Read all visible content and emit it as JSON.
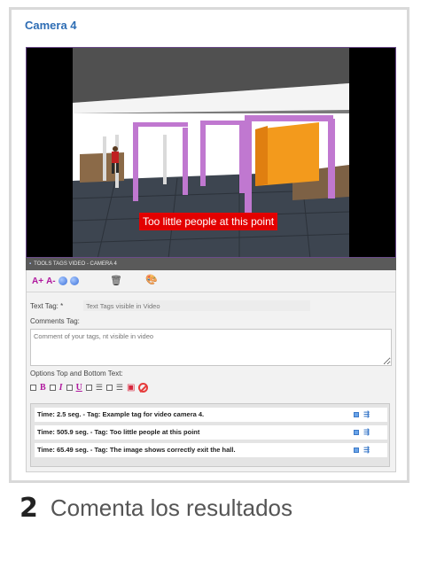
{
  "camera": {
    "title": "Camera 4"
  },
  "video": {
    "caption": "Too little people at this point"
  },
  "tools": {
    "bar_title": "TOOLS TAGS VIDEO - CAMERA 4",
    "font_increase": "A+",
    "font_decrease": "A-",
    "text_tag_label": "Text Tag: *",
    "text_tag_placeholder": "Text Tags visible in Video",
    "comments_label": "Comments Tag:",
    "comments_placeholder": "Comment of your tags, nt visible in video",
    "options_label": "Options Top and Bottom Text:",
    "bold": "B",
    "italic": "I",
    "underline": "U"
  },
  "tags": [
    "Time: 2.5 seg. - Tag: Example tag for video camera 4.",
    "Time: 505.9 seg. - Tag: Too little people at this point",
    "Time: 65.49 seg. - Tag: The image shows correctly exit the hall."
  ],
  "footer": {
    "step": "2",
    "text": "Comenta los resultados"
  },
  "colors": {
    "accent": "#2e6db4",
    "caption_bg": "#e30000",
    "format_icons": "#b0189e"
  },
  "icons": [
    "trash-icon",
    "palette-icon",
    "save-icon",
    "cancel-icon",
    "play-icon",
    "edit-icon"
  ]
}
